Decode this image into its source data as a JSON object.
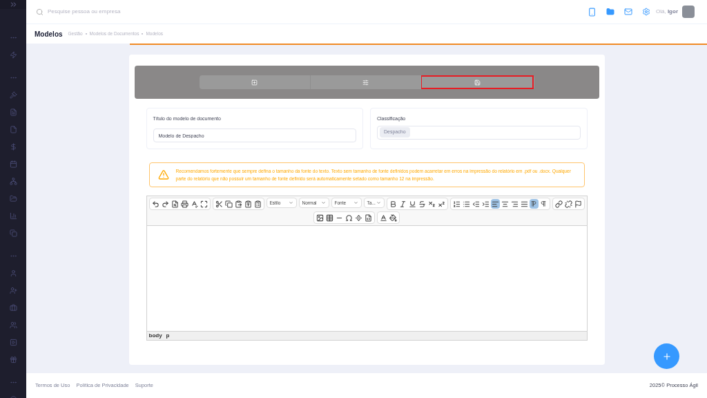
{
  "search": {
    "placeholder": "Pesquise pessoa ou empresa"
  },
  "user": {
    "greeting": "Olá,",
    "name": "Igor"
  },
  "page": {
    "title": "Modelos",
    "breadcrumb": [
      "Gestão",
      "Modelos de Documentos",
      "Modelos"
    ]
  },
  "steps": [
    {
      "kind": "add",
      "selected": false
    },
    {
      "kind": "settings",
      "selected": false
    },
    {
      "kind": "save",
      "selected": true
    }
  ],
  "form": {
    "title_label": "Título do modelo de documento",
    "title_value": "Modelo de Despacho",
    "class_label": "Classificação",
    "class_tag": "Despacho"
  },
  "warning": "Recomendamos fortemente que sempre defina o tamanho da fonte do texto. Texto sem tamanho de fonte definidos podem acarretar em erros na impressão do relatório em .pdf ou .docx. Qualquer parte do relatório que não possuir um tamanho de fonte definido será automaticamente setado como tamanho 12 na impressão.",
  "editor": {
    "dropdowns": [
      "Estilo",
      "Normal",
      "Fonte",
      "Ta..."
    ],
    "align": [
      {
        "kind": "left",
        "selected": true
      },
      {
        "kind": "center",
        "selected": false
      },
      {
        "kind": "right",
        "selected": false
      },
      {
        "kind": "justify",
        "selected": false
      }
    ],
    "direction": [
      {
        "kind": "ltr",
        "selected": true
      },
      {
        "kind": "rtl",
        "selected": false
      }
    ],
    "path": [
      "body",
      "p"
    ]
  },
  "footer": {
    "links": [
      "Termos de Uso",
      "Política de Privacidade",
      "Suporte"
    ],
    "copyright": "2025© Processo Ágil"
  }
}
